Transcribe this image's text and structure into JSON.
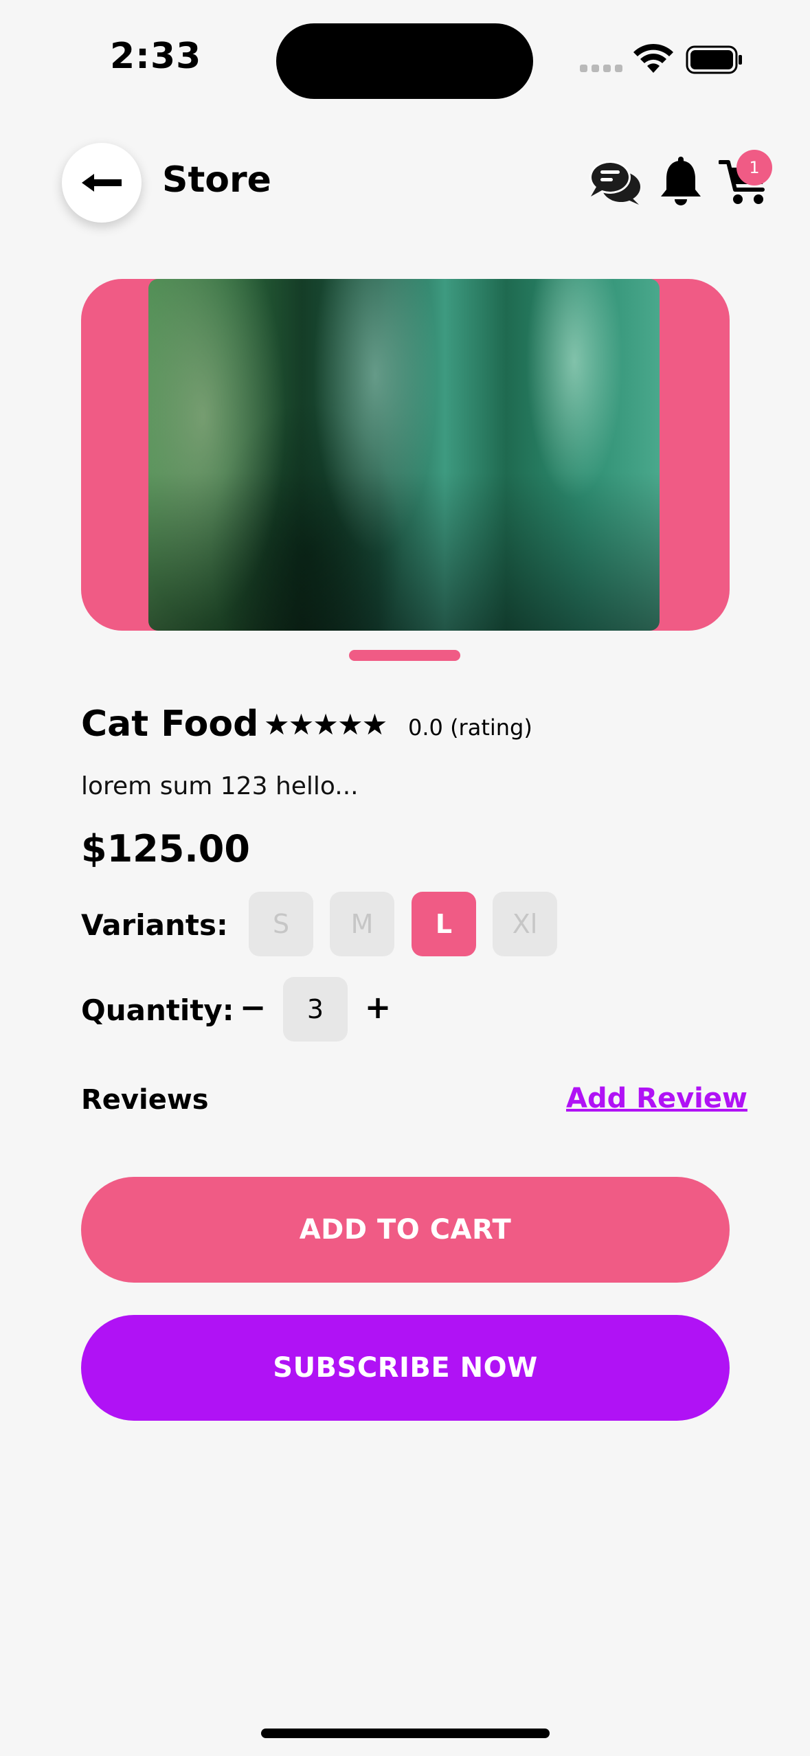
{
  "status_bar": {
    "time": "2:33"
  },
  "header": {
    "title": "Store",
    "cart_count": "1",
    "icons": [
      "back-arrow-icon",
      "chat-icon",
      "bell-icon",
      "cart-icon"
    ]
  },
  "product": {
    "name": "Cat Food",
    "stars": "★★★★★",
    "rating_text": "0.0 (rating)",
    "description": "lorem sum 123 hello...",
    "price": "$125.00",
    "variants_label": "Variants:",
    "variants": [
      {
        "label": "S",
        "selected": false
      },
      {
        "label": "M",
        "selected": false
      },
      {
        "label": "L",
        "selected": true
      },
      {
        "label": "Xl",
        "selected": false
      }
    ],
    "quantity_label": "Quantity:",
    "quantity_minus": "−",
    "quantity_value": "3",
    "quantity_plus": "+"
  },
  "reviews": {
    "label": "Reviews",
    "add_review": "Add Review"
  },
  "actions": {
    "add_to_cart": "ADD TO CART",
    "subscribe": "SUBSCRIBE NOW"
  },
  "colors": {
    "accent_pink": "#f05b85",
    "accent_purple": "#b012f5",
    "background": "#f6f6f6"
  }
}
